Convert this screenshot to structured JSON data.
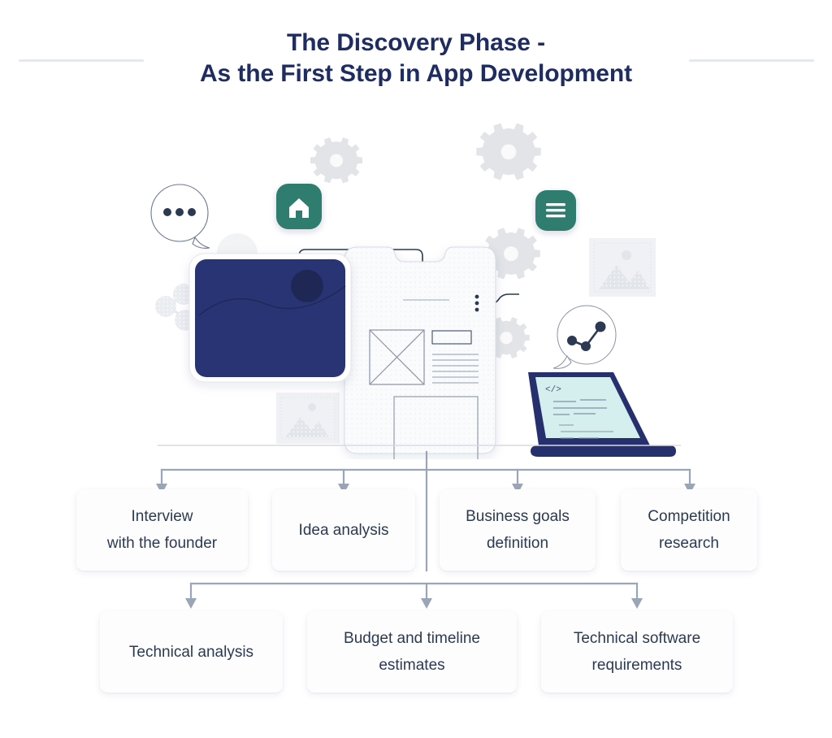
{
  "header": {
    "title_line1": "The Discovery Phase -",
    "title_line2": "As the First Step in App Development",
    "title_full": "The Discovery Phase - As the First Step in App Development"
  },
  "illustration": {
    "alt": "App discovery phase illustration with phone wireframe, tablet, laptop and UI icons",
    "icons": [
      {
        "name": "user-avatar-icon",
        "label": "user"
      },
      {
        "name": "chat-bubble-ellipsis-icon",
        "label": "chat"
      },
      {
        "name": "share-nodes-icon",
        "label": "share"
      },
      {
        "name": "home-app-icon",
        "label": "home"
      },
      {
        "name": "menu-app-icon",
        "label": "menu"
      },
      {
        "name": "image-placeholder-icon",
        "label": "image"
      },
      {
        "name": "analytics-bubble-icon",
        "label": "analytics"
      },
      {
        "name": "gear-icon",
        "label": "gear"
      },
      {
        "name": "code-tag",
        "label": "</>"
      }
    ]
  },
  "flow": {
    "row1": [
      {
        "id": "interview",
        "label": "Interview\nwith the founder",
        "line1": "Interview",
        "line2": "with the founder"
      },
      {
        "id": "idea-analysis",
        "label": "Idea analysis",
        "line1": "Idea analysis",
        "line2": ""
      },
      {
        "id": "business-goals",
        "label": "Business goals\ndefinition",
        "line1": "Business goals",
        "line2": "definition"
      },
      {
        "id": "competition-research",
        "label": "Competition\nresearch",
        "line1": "Competition",
        "line2": "research"
      }
    ],
    "row2": [
      {
        "id": "technical-analysis",
        "label": "Technical analysis",
        "line1": "Technical analysis",
        "line2": ""
      },
      {
        "id": "budget-timeline",
        "label": "Budget and timeline\nestimates",
        "line1": "Budget and timeline",
        "line2": "estimates"
      },
      {
        "id": "software-requirements",
        "label": "Technical software\nrequirements",
        "line1": "Technical software",
        "line2": "requirements"
      }
    ]
  },
  "colors": {
    "title_navy": "#1F2C62",
    "tablet_navy": "#283474",
    "laptop_navy": "#26306E",
    "accent_teal": "#2E7D6E",
    "card_text": "#2B3A52",
    "connector_gray": "#9AA6B8",
    "rule_gray": "#E3E9F1",
    "wireframe_gray": "#E8EBEF",
    "page_background": "#FFFFFF",
    "laptop_screen": "#D5EFEF"
  }
}
